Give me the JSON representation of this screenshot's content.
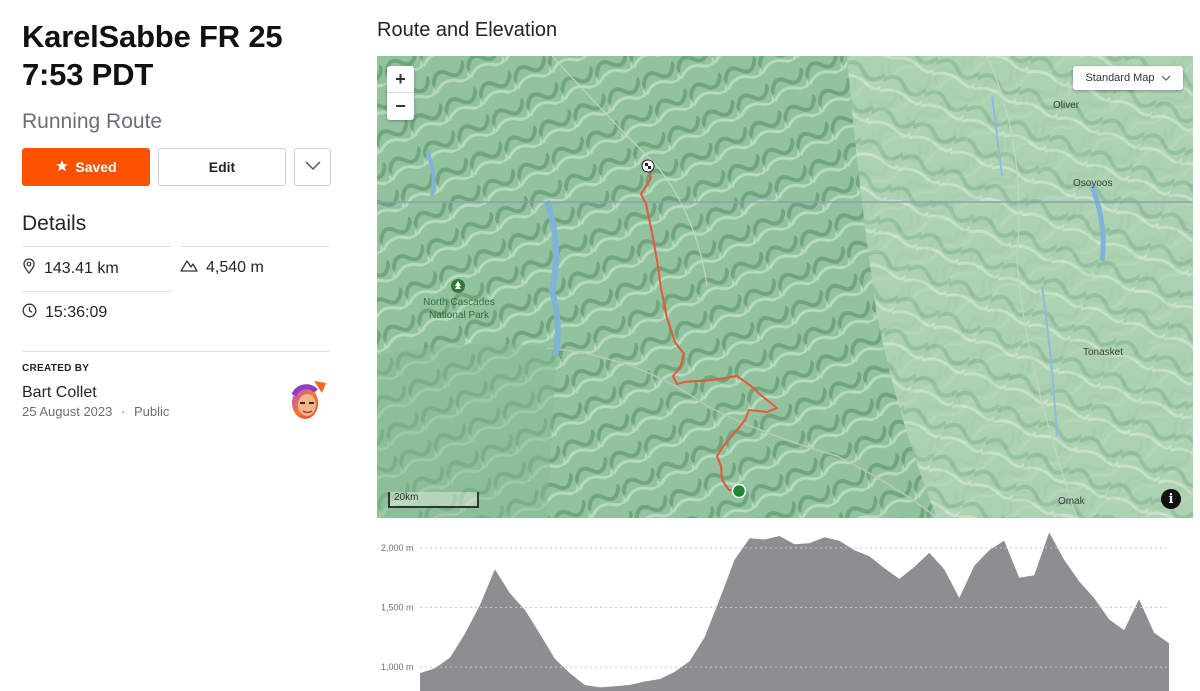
{
  "header": {
    "title_line1": "KarelSabbe FR 25",
    "title_line2": "7:53 PDT",
    "subtitle": "Running Route"
  },
  "actions": {
    "saved_label": "Saved",
    "edit_label": "Edit"
  },
  "details": {
    "heading": "Details",
    "distance": "143.41 km",
    "elevation_gain": "4,540 m",
    "est_time": "15:36:09"
  },
  "creator": {
    "label": "CREATED BY",
    "name": "Bart Collet",
    "date": "25 August 2023",
    "separator": "·",
    "visibility": "Public"
  },
  "map": {
    "section_title": "Route and Elevation",
    "zoom_in": "+",
    "zoom_out": "−",
    "map_type": "Standard Map",
    "scale_label": "20km",
    "info": "i",
    "labels": {
      "oliver": "Oliver",
      "osoyoos": "Osoyoos",
      "tonasket": "Tonasket",
      "omak": "Omak",
      "park_line1": "North Cascades",
      "park_line2": "National Park"
    },
    "route_color": "#e8573d",
    "start_color": "#1e8a30"
  },
  "chart_data": {
    "type": "area",
    "ylabel": "",
    "ylim": [
      800,
      2150
    ],
    "yticks": [
      {
        "value": 2000,
        "label": "2,000 m"
      },
      {
        "value": 1500,
        "label": "1,500 m"
      },
      {
        "value": 1000,
        "label": "1,000 m"
      }
    ],
    "fill_color": "#8e8e92",
    "x": [
      0,
      2,
      4,
      6,
      8,
      10,
      12,
      14,
      16,
      18,
      20,
      22,
      24,
      26,
      28,
      30,
      32,
      34,
      36,
      38,
      40,
      42,
      44,
      46,
      48,
      50,
      52,
      54,
      56,
      58,
      60,
      62,
      64,
      66,
      68,
      70,
      72,
      74,
      76,
      78,
      80,
      82,
      84,
      86,
      88,
      90,
      92,
      94,
      96,
      98,
      100
    ],
    "values": [
      950,
      990,
      1080,
      1280,
      1520,
      1820,
      1620,
      1480,
      1280,
      1070,
      950,
      850,
      830,
      840,
      850,
      880,
      900,
      960,
      1050,
      1250,
      1570,
      1900,
      2080,
      2070,
      2100,
      2030,
      2040,
      2090,
      2060,
      1980,
      1930,
      1830,
      1740,
      1840,
      1960,
      1820,
      1580,
      1850,
      1980,
      2060,
      1750,
      1770,
      2130,
      1900,
      1720,
      1580,
      1400,
      1310,
      1570,
      1290,
      1200
    ]
  }
}
